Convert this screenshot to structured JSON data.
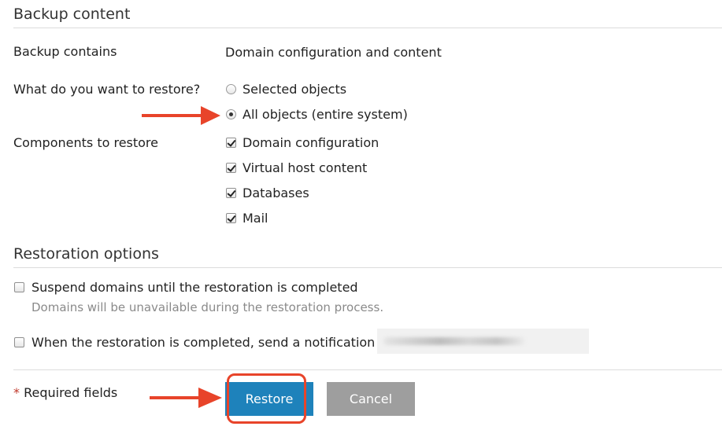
{
  "backup_content": {
    "title": "Backup content",
    "contains_label": "Backup contains",
    "contains_value": "Domain configuration and content",
    "restore_question": "What do you want to restore?",
    "restore_options": [
      {
        "label": "Selected objects",
        "selected": false
      },
      {
        "label": "All objects (entire system)",
        "selected": true
      }
    ],
    "components_label": "Components to restore",
    "components": [
      {
        "label": "Domain configuration",
        "checked": true
      },
      {
        "label": "Virtual host content",
        "checked": true
      },
      {
        "label": "Databases",
        "checked": true
      },
      {
        "label": "Mail",
        "checked": true
      }
    ]
  },
  "restoration_options": {
    "title": "Restoration options",
    "suspend_label": "Suspend domains until the restoration is completed",
    "suspend_checked": false,
    "suspend_hint": "Domains will be unavailable during the restoration process.",
    "notify_label": "When the restoration is completed, send a notification to",
    "notify_checked": false
  },
  "footer": {
    "required_star": "*",
    "required_text": "Required fields",
    "restore_button": "Restore",
    "cancel_button": "Cancel"
  },
  "annotation_color": "#e8442a",
  "primary_color": "#1e82bb"
}
